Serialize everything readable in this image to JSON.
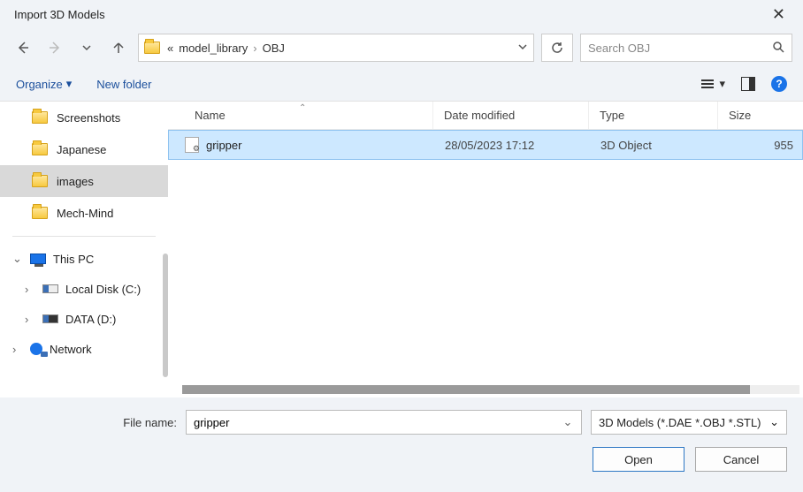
{
  "title": "Import 3D Models",
  "breadcrumbs": {
    "ellipsis": "«",
    "parent": "model_library",
    "current": "OBJ"
  },
  "search": {
    "placeholder": "Search OBJ"
  },
  "toolbar": {
    "organize": "Organize",
    "newfolder": "New folder"
  },
  "sidebar": {
    "quick": [
      "Screenshots",
      "Japanese",
      "images",
      "Mech-Mind"
    ],
    "selected_index": 2,
    "thispc": "This PC",
    "drives": [
      "Local Disk (C:)",
      "DATA (D:)"
    ],
    "network": "Network"
  },
  "columns": {
    "name": "Name",
    "date": "Date modified",
    "type": "Type",
    "size": "Size"
  },
  "files": [
    {
      "name": "gripper",
      "date": "28/05/2023 17:12",
      "type": "3D Object",
      "size": "955"
    }
  ],
  "footer": {
    "label": "File name:",
    "value": "gripper",
    "filter": "3D Models (*.DAE *.OBJ *.STL)",
    "open": "Open",
    "cancel": "Cancel"
  }
}
